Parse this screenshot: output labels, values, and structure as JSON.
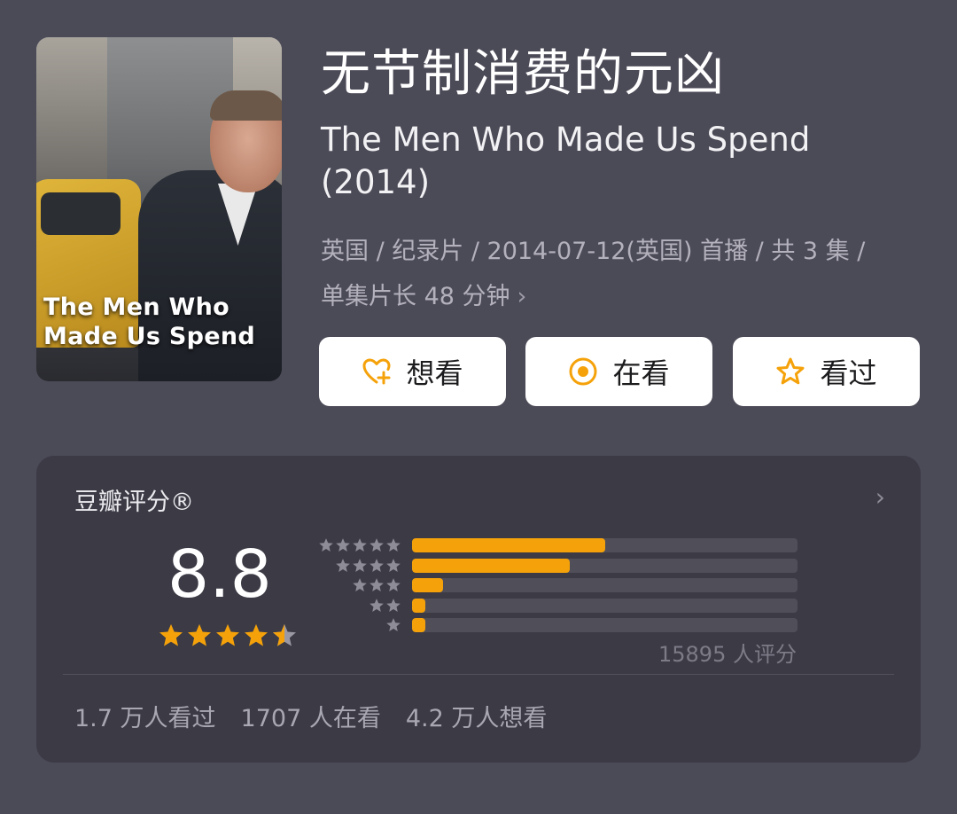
{
  "poster": {
    "title_line1": "The Men Who",
    "title_line2": "Made Us Spend"
  },
  "title_cn": "无节制消费的元凶",
  "title_en": "The Men Who Made Us Spend (2014)",
  "meta_line1": "英国 / 纪录片 / 2014-07-12(英国) 首播 / 共 3 集 /",
  "meta_line2": "单集片长 48 分钟",
  "actions": {
    "want": {
      "label": "想看",
      "icon": "heart-plus-icon"
    },
    "watching": {
      "label": "在看",
      "icon": "target-circle-icon"
    },
    "watched": {
      "label": "看过",
      "icon": "star-outline-icon"
    }
  },
  "rating": {
    "label": "豆瓣评分®",
    "score": "8.8",
    "stars": 4.5,
    "distribution": [
      {
        "stars": 5,
        "fraction": 0.5
      },
      {
        "stars": 4,
        "fraction": 0.41
      },
      {
        "stars": 3,
        "fraction": 0.08
      },
      {
        "stars": 2,
        "fraction": 0.035
      },
      {
        "stars": 1,
        "fraction": 0.035
      }
    ],
    "count_text": "15895 人评分"
  },
  "stats": {
    "watched": "1.7 万人看过",
    "watching": "1707 人在看",
    "want": "4.2 万人想看"
  },
  "colors": {
    "accent": "#f5a20a",
    "background": "#4b4a57",
    "card": "#3b3a45"
  }
}
